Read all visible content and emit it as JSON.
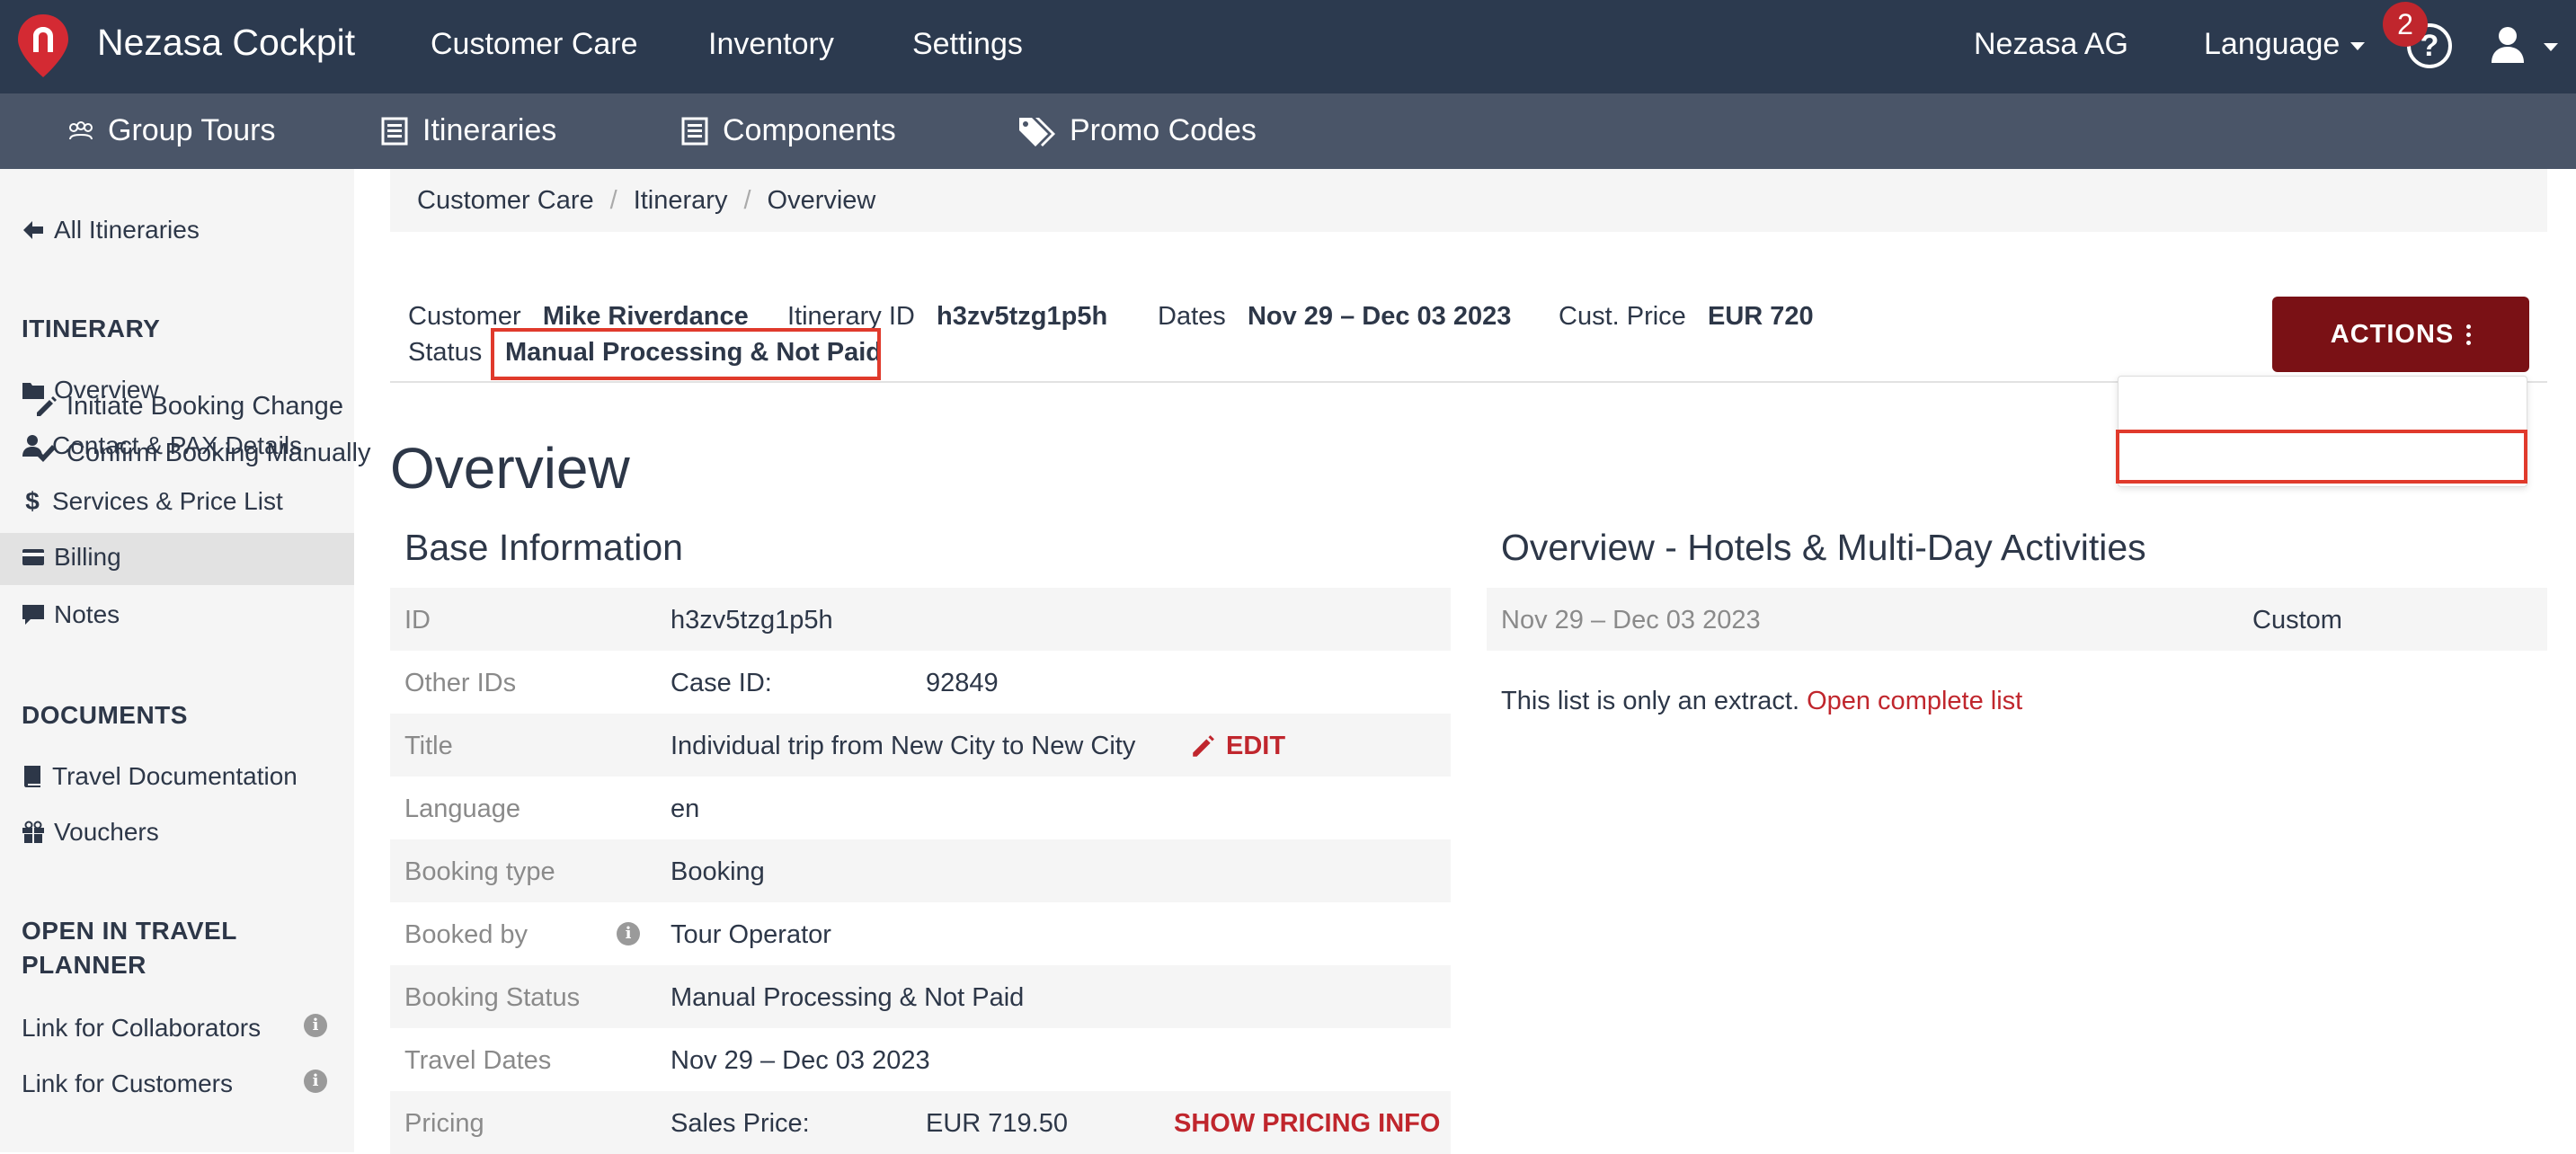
{
  "topbar": {
    "brand": "Nezasa Cockpit",
    "nav": [
      "Customer Care",
      "Inventory",
      "Settings"
    ],
    "company": "Nezasa AG",
    "language": "Language",
    "help_icon": "?",
    "notifications_count": "2"
  },
  "subnav": {
    "items": [
      "Group Tours",
      "Itineraries",
      "Components",
      "Promo Codes"
    ]
  },
  "sidebar": {
    "back_link": "All Itineraries",
    "itinerary_heading": "ITINERARY",
    "itinerary_items": [
      "Overview",
      "Contact & PAX Details",
      "Services & Price List",
      "Billing",
      "Notes"
    ],
    "documents_heading": "DOCUMENTS",
    "documents_items": [
      "Travel Documentation",
      "Vouchers"
    ],
    "planner_heading_1": "OPEN IN TRAVEL",
    "planner_heading_2": "PLANNER",
    "planner_items": [
      "Link for Collaborators",
      "Link for Customers"
    ]
  },
  "breadcrumb": [
    "Customer Care",
    "Itinerary",
    "Overview"
  ],
  "header": {
    "customer_label": "Customer",
    "customer_value": "Mike Riverdance",
    "itinerary_id_label": "Itinerary ID",
    "itinerary_id_value": "h3zv5tzg1p5h",
    "dates_label": "Dates",
    "dates_value": "Nov 29 – Dec 03 2023",
    "price_label": "Cust. Price",
    "price_value": "EUR 720",
    "status_label": "Status",
    "status_value": "Manual Processing & Not Paid"
  },
  "actions": {
    "button_label": "ACTIONS",
    "menu": [
      "Initiate Booking Change",
      "Confirm Booking Manually"
    ]
  },
  "page_title": "Overview",
  "base_info": {
    "title": "Base Information",
    "id_label": "ID",
    "id_value": "h3zv5tzg1p5h",
    "other_ids_label": "Other IDs",
    "case_id_label": "Case ID:",
    "case_id_value": "92849",
    "title_label": "Title",
    "title_value": "Individual trip from New City to New City",
    "edit_label": "EDIT",
    "language_label": "Language",
    "language_value": "en",
    "booking_type_label": "Booking type",
    "booking_type_value": "Booking",
    "booked_by_label": "Booked by",
    "booked_by_value": "Tour Operator",
    "booking_status_label": "Booking Status",
    "booking_status_value": "Manual Processing & Not Paid",
    "travel_dates_label": "Travel Dates",
    "travel_dates_value": "Nov 29 – Dec 03 2023",
    "pricing_label": "Pricing",
    "sales_price_label": "Sales Price:",
    "sales_price_value": "EUR 719.50",
    "show_pricing_label": "SHOW PRICING INFO"
  },
  "hotels": {
    "title": "Overview - Hotels & Multi-Day Activities",
    "row_dates": "Nov 29 – Dec 03 2023",
    "row_type": "Custom",
    "extract_text": "This list is only an extract.",
    "open_list_link": "Open complete list"
  },
  "colors": {
    "topbar_bg": "#2c3a4f",
    "subbar_bg": "#4a5568",
    "actions_bg": "#7a1115",
    "accent_red": "#c0262d",
    "highlight_border": "#e03a2c"
  }
}
